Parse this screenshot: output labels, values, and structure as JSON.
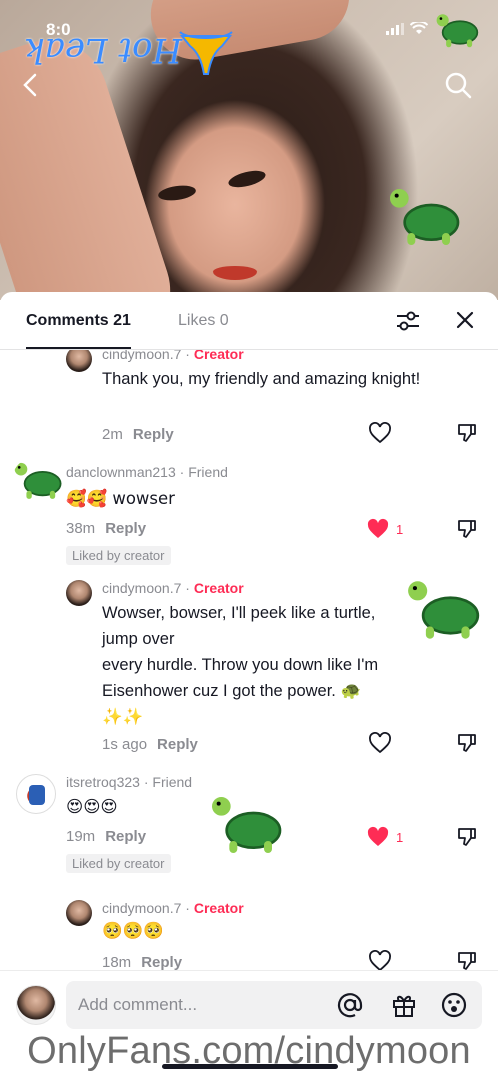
{
  "status_bar": {
    "time": "8:0",
    "signal_icon": "signal-bars-icon",
    "wifi_icon": "wifi-icon"
  },
  "video": {
    "overlay_logo_text": "Hot Leak",
    "nav_back_icon": "chevron-left-icon",
    "nav_search_icon": "search-icon"
  },
  "tabs": [
    {
      "label": "Comments 21",
      "active": true
    },
    {
      "label": "Likes 0",
      "active": false
    }
  ],
  "sheet_actions": {
    "filter_icon": "sliders-icon",
    "close_icon": "close-icon"
  },
  "comments": [
    {
      "username": "cindymoon.7",
      "tag": "Creator",
      "text": "Thank you, my friendly and amazing knight!",
      "time": "2m",
      "reply_label": "Reply"
    },
    {
      "username": "danclownman213",
      "tag": "Friend",
      "text": "🥰🥰 wowser",
      "time": "38m",
      "reply_label": "Reply",
      "like_count": "1",
      "liked_badge": "Liked by creator"
    },
    {
      "username": "cindymoon.7",
      "tag": "Creator",
      "text_lines": [
        "Wowser, bowser, I'll peek like a turtle,",
        "jump over",
        "every hurdle. Throw you down like I'm",
        "Eisenhower cuz I got the power. 🐢",
        "✨✨"
      ],
      "time": "1s ago",
      "reply_label": "Reply"
    },
    {
      "username": "itsretroq323",
      "tag": "Friend",
      "text": "😍😍😍",
      "time": "19m",
      "reply_label": "Reply",
      "like_count": "1",
      "liked_badge": "Liked by creator"
    },
    {
      "username": "cindymoon.7",
      "tag": "Creator",
      "text": "🥺🥺🥺",
      "time": "18m",
      "reply_label": "Reply"
    }
  ],
  "input": {
    "placeholder": "Add comment...",
    "icons": [
      "at-sign-icon",
      "gift-icon",
      "emoji-icon"
    ]
  },
  "footer_watermark": "OnlyFans.com/cindymoon",
  "colors": {
    "creator_tag": "#fe2c55",
    "liked_heart": "#fe2c55",
    "overlay_logo": "#3b8cff",
    "text_primary": "#161823",
    "text_secondary": "#8a8b91"
  }
}
